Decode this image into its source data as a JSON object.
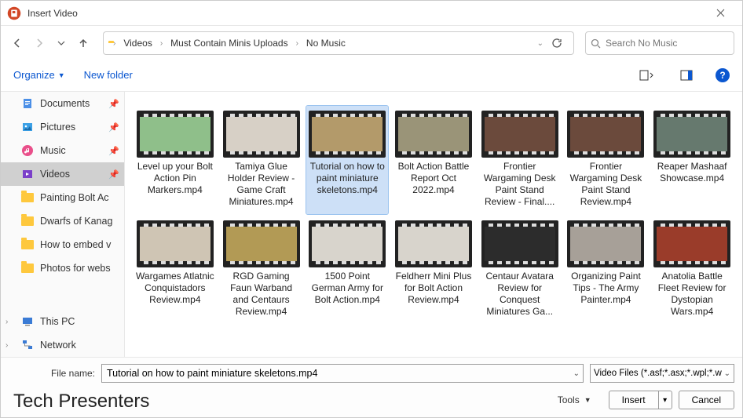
{
  "window": {
    "title": "Insert Video"
  },
  "breadcrumbs": {
    "root": "Videos",
    "mid": "Must Contain Minis Uploads",
    "leaf": "No Music"
  },
  "search": {
    "placeholder": "Search No Music"
  },
  "toolbar": {
    "organize": "Organize",
    "newfolder": "New folder"
  },
  "sidebar": {
    "items": [
      {
        "label": "Documents",
        "icon": "doc",
        "pinned": true
      },
      {
        "label": "Pictures",
        "icon": "pic",
        "pinned": true
      },
      {
        "label": "Music",
        "icon": "music",
        "pinned": true
      },
      {
        "label": "Videos",
        "icon": "video",
        "pinned": true,
        "selected": true
      },
      {
        "label": "Painting Bolt Ac",
        "icon": "folder"
      },
      {
        "label": "Dwarfs of Kanag",
        "icon": "folder"
      },
      {
        "label": "How to embed v",
        "icon": "folder"
      },
      {
        "label": "Photos for webs",
        "icon": "folder"
      }
    ],
    "lower": [
      {
        "label": "This PC",
        "icon": "pc",
        "expand": true
      },
      {
        "label": "Network",
        "icon": "net",
        "expand": true
      }
    ]
  },
  "files": [
    {
      "name": "Level up your Bolt Action Pin Markers.mp4",
      "bg": "#8fbf8a"
    },
    {
      "name": "Tamiya Glue Holder Review - Game Craft Miniatures.mp4",
      "bg": "#d7d0c6"
    },
    {
      "name": "Tutorial on how to paint miniature skeletons.mp4",
      "bg": "#b39a6a",
      "selected": true
    },
    {
      "name": "Bolt Action Battle Report Oct 2022.mp4",
      "bg": "#9a9478"
    },
    {
      "name": "Frontier Wargaming Desk Paint Stand Review - Final....",
      "bg": "#6b4a3c"
    },
    {
      "name": "Frontier Wargaming Desk Paint Stand Review.mp4",
      "bg": "#6b4a3c"
    },
    {
      "name": "Reaper Mashaaf Showcase.mp4",
      "bg": "#66796e"
    },
    {
      "name": "Wargames Atlatnic Conquistadors Review.mp4",
      "bg": "#cfc5b4"
    },
    {
      "name": "RGD Gaming Faun Warband and Centaurs Review.mp4",
      "bg": "#b29a55"
    },
    {
      "name": "1500 Point German Army for Bolt Action.mp4",
      "bg": "#d8d4cc"
    },
    {
      "name": "Feldherr Mini Plus for Bolt Action Review.mp4",
      "bg": "#d8d4cc"
    },
    {
      "name": "Centaur Avatara Review for Conquest Miniatures Ga...",
      "bg": "#2c2c2c"
    },
    {
      "name": "Organizing Paint Tips - The Army Painter.mp4",
      "bg": "#a7a098"
    },
    {
      "name": "Anatolia Battle Fleet Review for Dystopian Wars.mp4",
      "bg": "#9a3c2a"
    }
  ],
  "footer": {
    "filename_label": "File name:",
    "filename_value": "Tutorial on how to paint miniature skeletons.mp4",
    "filetype": "Video Files (*.asf;*.asx;*.wpl;*.w",
    "tools": "Tools",
    "insert": "Insert",
    "cancel": "Cancel"
  },
  "watermark": "Tech Presenters"
}
